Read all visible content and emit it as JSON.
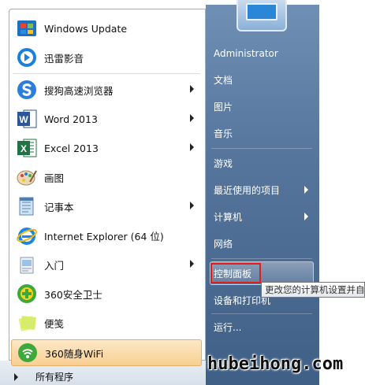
{
  "programs": [
    {
      "label": "Windows Update",
      "icon": "windows-update-icon",
      "submenu": false
    },
    {
      "label": "迅雷影音",
      "icon": "xunlei-player-icon",
      "submenu": false
    },
    {
      "label": "搜狗高速浏览器",
      "icon": "sogou-browser-icon",
      "submenu": true
    },
    {
      "label": "Word 2013",
      "icon": "word-icon",
      "submenu": true
    },
    {
      "label": "Excel 2013",
      "icon": "excel-icon",
      "submenu": true
    },
    {
      "label": "画图",
      "icon": "paint-icon",
      "submenu": false
    },
    {
      "label": "记事本",
      "icon": "notepad-icon",
      "submenu": true
    },
    {
      "label": "Internet Explorer (64 位)",
      "icon": "internet-explorer-icon",
      "submenu": false
    },
    {
      "label": "入门",
      "icon": "getting-started-icon",
      "submenu": true
    },
    {
      "label": "360安全卫士",
      "icon": "360-safe-icon",
      "submenu": false
    },
    {
      "label": "便笺",
      "icon": "sticky-notes-icon",
      "submenu": false
    },
    {
      "label": "360随身WiFi",
      "icon": "360-wifi-icon",
      "submenu": false
    }
  ],
  "all_programs": "所有程序",
  "right": {
    "user": "Administrator",
    "items": [
      {
        "label": "文档",
        "submenu": false
      },
      {
        "label": "图片",
        "submenu": false
      },
      {
        "label": "音乐",
        "submenu": false
      },
      {
        "label": "游戏",
        "submenu": false
      },
      {
        "label": "最近使用的项目",
        "submenu": true
      },
      {
        "label": "计算机",
        "submenu": true
      },
      {
        "label": "网络",
        "submenu": false
      },
      {
        "label": "控制面板",
        "submenu": false
      },
      {
        "label": "设备和打印机",
        "submenu": false
      },
      {
        "label": "运行...",
        "submenu": false
      }
    ]
  },
  "tooltip": "更改您的计算机设置并自",
  "watermark": "hubeihong.com",
  "colors": {
    "highlight": "#f8cf92",
    "right_pane": "#56759c",
    "red_box": "#e21b1b"
  }
}
